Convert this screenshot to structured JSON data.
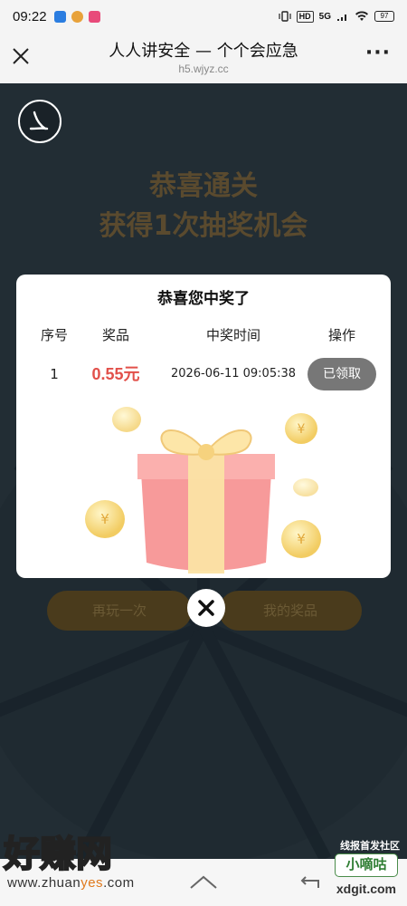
{
  "status_bar": {
    "time": "09:22",
    "hd": "HD",
    "network": "5G",
    "battery": "97"
  },
  "browser": {
    "title": "人人讲安全 — 个个会应急",
    "url": "h5.wjyz.cc"
  },
  "background": {
    "banner_line1": "恭喜通关",
    "banner_line2": "获得1次抽奖机会",
    "play_again_label": "再玩一次",
    "my_prizes_label": "我的奖品"
  },
  "modal": {
    "title": "恭喜您中奖了",
    "columns": [
      "序号",
      "奖品",
      "中奖时间",
      "操作"
    ],
    "rows": [
      {
        "index": "1",
        "prize": "0.55元",
        "time": "2026-06-11 09:05:38",
        "action": "已领取"
      }
    ]
  },
  "watermark": {
    "left_text": "好赚网",
    "left_url_a": "www.zhuan",
    "left_url_b": "yes",
    "left_url_c": ".com",
    "right_top": "线报首发社区",
    "right_badge": "小嘀咕",
    "right_url": "xdgit.com"
  },
  "colors": {
    "prize_red": "#e2504a",
    "claimed_gray": "#777777",
    "page_bg": "#222d34"
  }
}
